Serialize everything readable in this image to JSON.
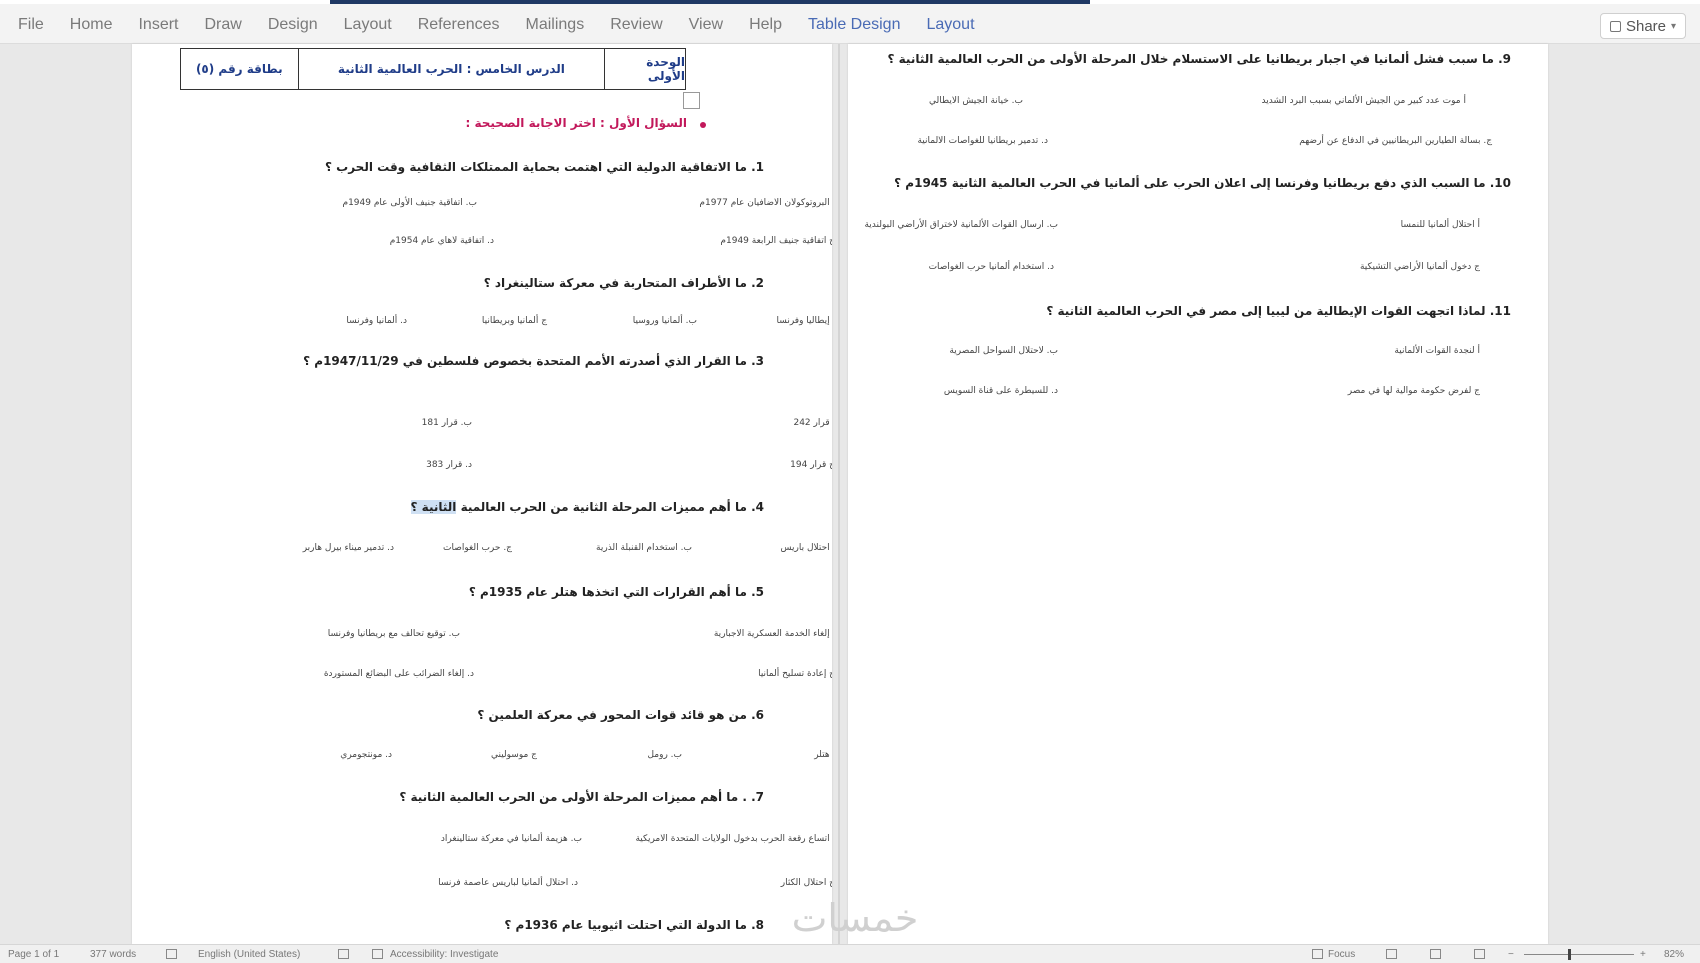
{
  "ribbon": {
    "tabs": [
      "File",
      "Home",
      "Insert",
      "Draw",
      "Design",
      "Layout",
      "References",
      "Mailings",
      "Review",
      "View",
      "Help"
    ],
    "context_tabs": [
      "Table Design",
      "Layout"
    ],
    "share_label": "Share"
  },
  "header_table": {
    "card": "بطاقة رقم (٥)",
    "lesson": "الدرس الخامس : الحرب العالمية الثانية",
    "unit": "الوحدة الأولى"
  },
  "section_title": "السؤال الأول : اختر الاجابة الصحيحة :",
  "page1_questions": [
    {
      "text": "1. ما الاتفاقية الدولية التي اهتمت بحماية الممتلكات الثقافية وقت الحرب ؟",
      "options": [
        "أ البروتوكولان الاضافيان عام 1977م",
        "ب. اتفاقية جنيف الأولى عام 1949م",
        "ج اتفاقية جنيف الرابعة 1949م",
        "د. اتفاقية لاهاي عام 1954م"
      ]
    },
    {
      "text": "2. ما الأطراف المتحاربة في معركة ستالينغراد ؟",
      "options": [
        "أ إيطاليا وفرنسا",
        "ب. ألمانيا وروسيا",
        "ج ألمانيا وبريطانيا",
        "د. ألمانيا وفرنسا"
      ]
    },
    {
      "text": "3. ما القرار الذي أصدرته الأمم المتحدة بخصوص فلسطين في 1947/11/29م ؟",
      "options": [
        "أ قرار 242",
        "ب. قرار 181",
        "ج قرار 194",
        "د. قرار 383"
      ]
    },
    {
      "text_main": "4. ما أهم مميزات المرحلة الثانية من الحرب العالمية ",
      "text_highlight": "الثانية ؟",
      "options": [
        "أ احتلال باريس",
        "ب. استخدام القنبلة الذرية",
        "ج. حرب الغواصات",
        "د. تدمير ميناء بيرل هاربر"
      ]
    },
    {
      "text": "5. ما أهم القرارات التي اتخذها هتلر عام 1935م ؟",
      "options": [
        "أ إلغاء الخدمة العسكرية الاجبارية",
        "ب. توقيع تحالف مع بريطانيا وفرنسا",
        "ج إعادة تسليح ألمانيا",
        "د. إلغاء الضرائب على البضائع المستوردة"
      ]
    },
    {
      "text": "6. من هو قائد قوات المحور في معركة العلمين ؟",
      "options": [
        "أ هتلر",
        "ب. رومل",
        "ج موسوليني",
        "د. مونتجومري"
      ]
    },
    {
      "text": "7. . ما أهم مميزات المرحلة الأولى من الحرب العالمية الثانية ؟",
      "options": [
        "أ اتساع رقعة الحرب بدخول الولايات المتحدة الامريكية",
        "ب. هزيمة ألمانيا في معركة ستالينغراد",
        "ج احتلال الكثار",
        "د. احتلال ألمانيا لباريس عاصمة فرنسا"
      ]
    },
    {
      "text": "8. ما الدولة التي احتلت اثيوبيا عام 1936م ؟",
      "options": []
    }
  ],
  "page2_questions": [
    {
      "text": "9. ما سبب فشل ألمانيا في اجبار بريطانيا على الاستسلام خلال المرحلة الأولى من الحرب العالمية الثانية ؟",
      "options": [
        "أ موت عدد كبير من الجيش الألماني بسبب البرد الشديد",
        "ب. خيانة الجيش الايطالي",
        "ج. بسالة الطيارين البريطانيين في الدفاع عن أرضهم",
        "د. تدمير بريطانيا للغواصات الالمانية"
      ]
    },
    {
      "text": "10. ما السبب الذي دفع بريطانيا وفرنسا إلى اعلان الحرب على ألمانيا في الحرب العالمية الثانية 1945م ؟",
      "options": [
        "أ احتلال ألمانيا للنمسا",
        "ب. ارسال القوات الألمانية لاختراق الأراضي البولندية",
        "ج دخول ألمانيا الأراضي التشيكية",
        "د. استخدام ألمانيا حرب الغواصات"
      ]
    },
    {
      "text": "11. لماذا اتجهت القوات الإيطالية من ليبيا إلى مصر في الحرب العالمية الثانية ؟",
      "options": [
        "أ لنجدة القوات الألمانية",
        "ب. لاحتلال السواحل المصرية",
        "ج لفرض حكومة موالية لها في مصر",
        "د. للسيطرة على قناة السويس"
      ]
    }
  ],
  "status": {
    "page": "Page 1 of 1",
    "words": "377 words",
    "language": "English (United States)",
    "accessibility": "Accessibility: Investigate",
    "focus": "Focus",
    "zoom": "82%",
    "minus": "−",
    "plus": "+"
  },
  "watermark": "خمسات"
}
